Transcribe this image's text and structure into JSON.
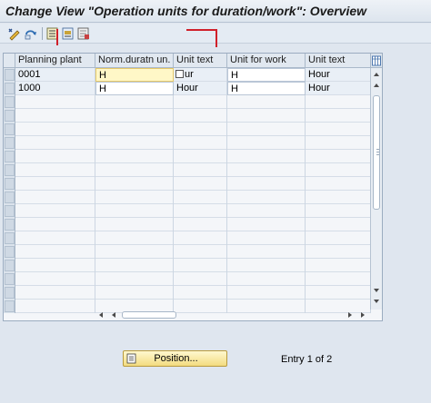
{
  "window": {
    "title": "Change View \"Operation units for duration/work\": Overview"
  },
  "toolbar": {
    "buttons": [
      {
        "name": "display-change-icon"
      },
      {
        "name": "other-view-icon"
      },
      {
        "name": "select-all-icon"
      },
      {
        "name": "select-block-icon"
      },
      {
        "name": "deselect-all-icon"
      }
    ]
  },
  "table": {
    "columns": [
      "Planning plant",
      "Norm.duratn un.",
      "Unit text",
      "Unit for work",
      "Unit text"
    ],
    "rows": [
      {
        "plant": "0001",
        "norm_unit": "H",
        "unit_text": "ur",
        "work_unit": "H",
        "work_text": "Hour"
      },
      {
        "plant": "1000",
        "norm_unit": "H",
        "unit_text": "Hour",
        "work_unit": "H",
        "work_text": "Hour"
      }
    ]
  },
  "footer": {
    "position_label": "Position...",
    "entry_text": "Entry 1 of 2"
  }
}
